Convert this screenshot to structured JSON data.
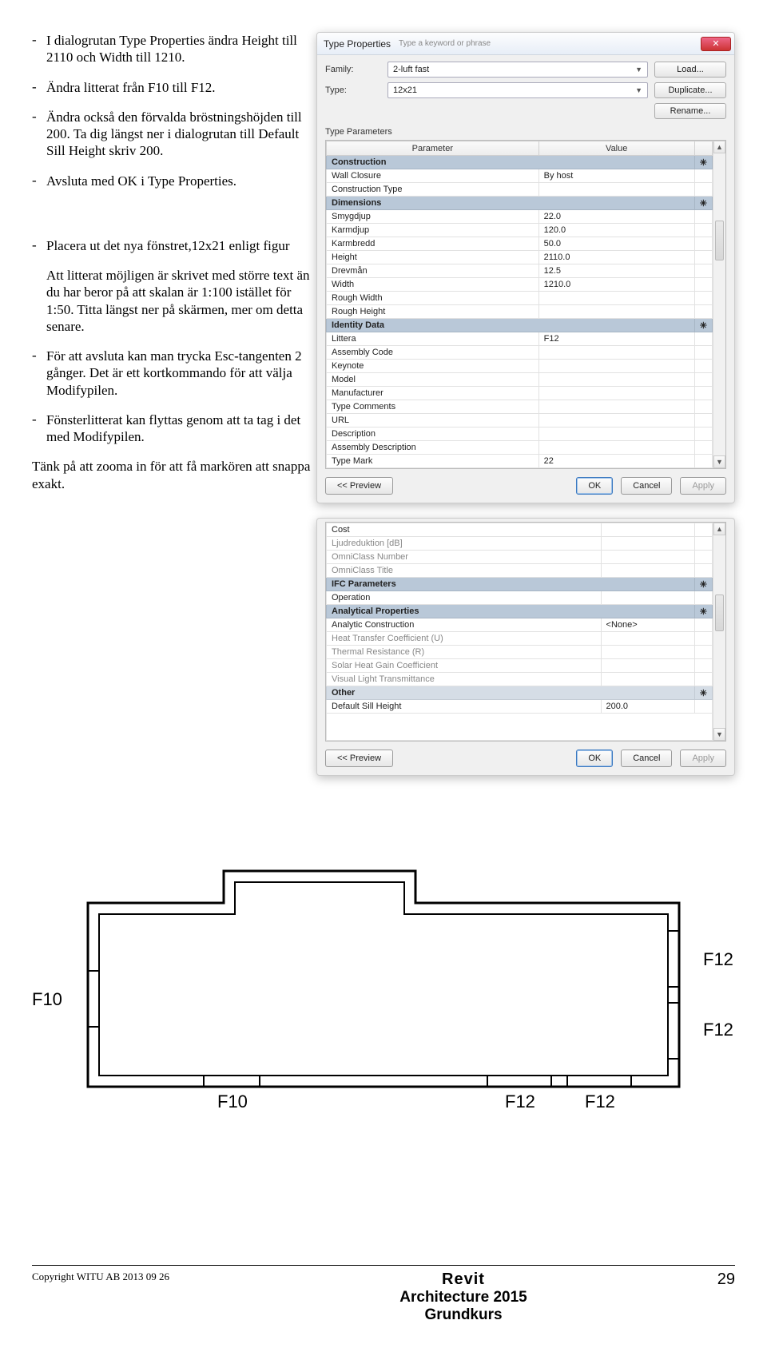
{
  "instructions": {
    "p1": "I dialogrutan Type Properties ändra Height till 2110 och Width till 1210.",
    "p2": "Ändra litterat från F10 till F12.",
    "p3": "Ändra också den förvalda bröstningshöjden till 200. Ta dig längst ner i dialogrutan till Default Sill Height skriv 200.",
    "p4": "Avsluta med OK i Type Properties.",
    "p5a": "Placera ut det nya fönstret,12x21 enligt figur",
    "p5b": "Att litterat möjligen är skrivet med större text än du har beror på att skalan är 1:100 istället för 1:50. Titta längst ner på skärmen, mer om detta senare.",
    "p6": "För att avsluta kan man trycka Esc-tangenten 2 gånger. Det är ett kortkommando för att välja Modifypilen.",
    "p7": "Fönsterlitterat kan flyttas genom att ta tag i det med Modifypilen.",
    "p8": "Tänk på att zooma in för att få markören att snappa exakt."
  },
  "dialog1": {
    "title": "Type Properties",
    "titlebar_hint": "Type a keyword or phrase",
    "close_glyph": "✕",
    "family_label": "Family:",
    "family_value": "2-luft fast",
    "type_label": "Type:",
    "type_value": "12x21",
    "btn_load": "Load...",
    "btn_duplicate": "Duplicate...",
    "btn_rename": "Rename...",
    "section_title": "Type Parameters",
    "col_param": "Parameter",
    "col_value": "Value",
    "groups": {
      "construction": "Construction",
      "dimensions": "Dimensions",
      "identity": "Identity Data"
    },
    "rows": {
      "wall_closure": {
        "p": "Wall Closure",
        "v": "By host"
      },
      "construction_type": {
        "p": "Construction Type",
        "v": ""
      },
      "smygdjup": {
        "p": "Smygdjup",
        "v": "22.0"
      },
      "karmdjup": {
        "p": "Karmdjup",
        "v": "120.0"
      },
      "karmbredd": {
        "p": "Karmbredd",
        "v": "50.0"
      },
      "height": {
        "p": "Height",
        "v": "2110.0"
      },
      "drevman": {
        "p": "Drevmån",
        "v": "12.5"
      },
      "width": {
        "p": "Width",
        "v": "1210.0"
      },
      "rough_width": {
        "p": "Rough Width",
        "v": ""
      },
      "rough_height": {
        "p": "Rough Height",
        "v": ""
      },
      "littera": {
        "p": "Littera",
        "v": "F12"
      },
      "assembly_code": {
        "p": "Assembly Code",
        "v": ""
      },
      "keynote": {
        "p": "Keynote",
        "v": ""
      },
      "model": {
        "p": "Model",
        "v": ""
      },
      "manufacturer": {
        "p": "Manufacturer",
        "v": ""
      },
      "type_comments": {
        "p": "Type Comments",
        "v": ""
      },
      "url": {
        "p": "URL",
        "v": ""
      },
      "description": {
        "p": "Description",
        "v": ""
      },
      "assembly_description": {
        "p": "Assembly Description",
        "v": ""
      },
      "type_mark": {
        "p": "Type Mark",
        "v": "22"
      }
    },
    "btn_preview": "<< Preview",
    "btn_ok": "OK",
    "btn_cancel": "Cancel",
    "btn_apply": "Apply"
  },
  "dialog2": {
    "rows": {
      "cost": {
        "p": "Cost",
        "v": ""
      },
      "ljud": {
        "p": "Ljudreduktion [dB]",
        "v": ""
      },
      "omniclass_number": {
        "p": "OmniClass Number",
        "v": ""
      },
      "omniclass_title": {
        "p": "OmniClass Title",
        "v": ""
      }
    },
    "groups": {
      "ifc": "IFC Parameters",
      "analytical": "Analytical Properties",
      "other": "Other"
    },
    "rows2": {
      "operation": {
        "p": "Operation",
        "v": ""
      },
      "analytic_construction": {
        "p": "Analytic Construction",
        "v": "<None>"
      },
      "heat_transfer": {
        "p": "Heat Transfer Coefficient (U)",
        "v": ""
      },
      "thermal_resistance": {
        "p": "Thermal Resistance (R)",
        "v": ""
      },
      "shgc": {
        "p": "Solar Heat Gain Coefficient",
        "v": ""
      },
      "vlt": {
        "p": "Visual Light Transmittance",
        "v": ""
      },
      "default_sill": {
        "p": "Default Sill Height",
        "v": "200.0"
      }
    },
    "btn_preview": "<< Preview",
    "btn_ok": "OK",
    "btn_cancel": "Cancel",
    "btn_apply": "Apply"
  },
  "plan_labels": {
    "f10_left": "F10",
    "f10_bottom": "F10",
    "f12_right1": "F12",
    "f12_right2": "F12",
    "f12_bottom1": "F12",
    "f12_bottom2": "F12"
  },
  "footer": {
    "copyright": "Copyright WITU AB 2013 09 26",
    "title1": "Revit",
    "title2": "Architecture 2015",
    "title3": "Grundkurs",
    "page": "29"
  }
}
